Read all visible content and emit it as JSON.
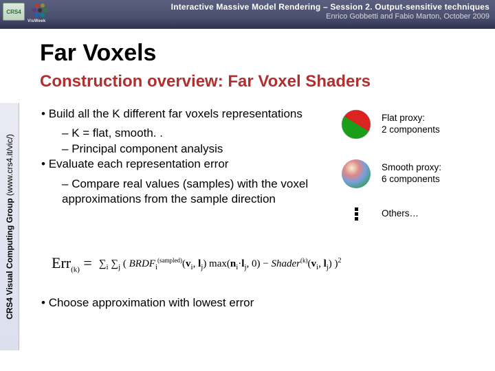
{
  "header": {
    "course": "Interactive Massive Model Rendering – Session 2. Output-sensitive techniques",
    "byline": "Enrico Gobbetti and Fabio Marton, October 2009",
    "logo1_text": "CRS4",
    "logo2_text": "VisWeek"
  },
  "titles": {
    "main": "Far Voxels",
    "sub": "Construction overview: Far Voxel Shaders"
  },
  "sidebar": {
    "group": "CRS4 Visual Computing Group",
    "url": " (www.crs4.it/vic/)"
  },
  "bullets": {
    "b1": "Build all the K different far voxels representations",
    "b1a": "K = flat, smooth. .",
    "b1b": "Principal component analysis",
    "b2": "Evaluate each representation error",
    "b2a": "Compare real values (samples) with the voxel approximations from the sample direction",
    "final": "Choose approximation with lowest error"
  },
  "equation": {
    "lhs": "Err(k) =",
    "rhs": "Σᵢ Σⱼ ( BRDFᵢ(sampled)(vᵢ, lⱼ) max(nᵢ·lⱼ, 0) − Shader(k)(vᵢ, lⱼ) )²"
  },
  "proxies": {
    "flat": "Flat proxy:\n2 components",
    "smooth": "Smooth proxy:\n6 components",
    "others": "Others…"
  }
}
